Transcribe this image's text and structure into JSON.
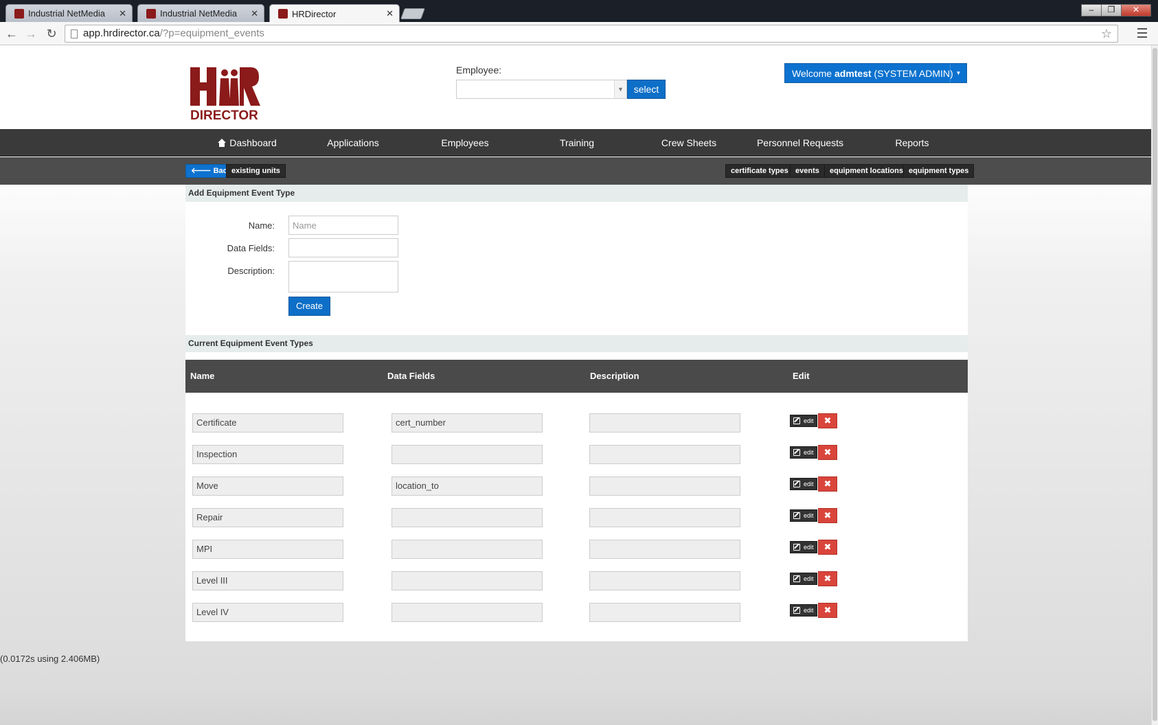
{
  "browser": {
    "tabs": [
      {
        "title": "Industrial NetMedia",
        "close": "✕",
        "active": false
      },
      {
        "title": "Industrial NetMedia",
        "close": "✕",
        "active": false
      },
      {
        "title": "HRDirector",
        "close": "✕",
        "active": true
      }
    ],
    "url_host": "app.hrdirector.ca",
    "url_path": "/?p=equipment_events",
    "window_controls": {
      "minimize": "–",
      "maximize": "❐",
      "close": "✕"
    }
  },
  "header": {
    "logo_text_top": "HR",
    "logo_text_bottom": "DIRECTOR",
    "employee_label": "Employee:",
    "employee_value": "",
    "select_button": "select",
    "welcome_prefix": "Welcome ",
    "welcome_user": "admtest",
    "welcome_role": " (SYSTEM ADMIN)"
  },
  "nav": {
    "items": [
      "Dashboard",
      "Applications",
      "Employees",
      "Training",
      "Crew Sheets",
      "Personnel Requests",
      "Reports"
    ]
  },
  "subnav": {
    "back": "Back",
    "existing_units": "existing units",
    "right": [
      "certificate types",
      "events",
      "equipment locations",
      "equipment types"
    ]
  },
  "add_form": {
    "title": "Add Equipment Event Type",
    "name_label": "Name:",
    "name_placeholder": "Name",
    "data_fields_label": "Data Fields:",
    "description_label": "Description:",
    "create_button": "Create"
  },
  "current": {
    "title": "Current Equipment Event Types",
    "columns": [
      "Name",
      "Data Fields",
      "Description",
      "Edit"
    ],
    "edit_label": "edit",
    "delete_label": "✖",
    "rows": [
      {
        "name": "Certificate",
        "data_fields": "cert_number",
        "description": ""
      },
      {
        "name": "Inspection",
        "data_fields": "",
        "description": ""
      },
      {
        "name": "Move",
        "data_fields": "location_to",
        "description": ""
      },
      {
        "name": "Repair",
        "data_fields": "",
        "description": ""
      },
      {
        "name": "MPI",
        "data_fields": "",
        "description": ""
      },
      {
        "name": "Level III",
        "data_fields": "",
        "description": ""
      },
      {
        "name": "Level IV",
        "data_fields": "",
        "description": ""
      }
    ]
  },
  "footer": {
    "stats": "(0.0172s using 2.406MB)"
  },
  "colors": {
    "brand_red": "#8b1a1a",
    "primary_blue": "#0d72cf",
    "danger_red": "#d9453b",
    "nav_dark": "#3a3a3a"
  }
}
